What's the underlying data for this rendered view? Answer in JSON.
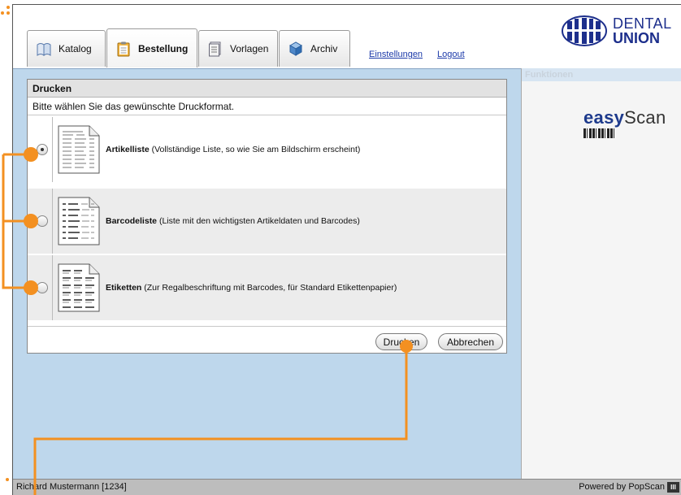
{
  "tabs": [
    {
      "label": "Katalog",
      "icon": "book-icon"
    },
    {
      "label": "Bestellung",
      "icon": "clipboard-icon",
      "active": true
    },
    {
      "label": "Vorlagen",
      "icon": "template-icon"
    },
    {
      "label": "Archiv",
      "icon": "archive-box-icon"
    }
  ],
  "header_links": {
    "settings": "Einstellungen",
    "logout": "Logout"
  },
  "logo": {
    "line1": "DENTAL",
    "line2": "UNION"
  },
  "functions": {
    "title": "Funktionen",
    "easy": "easy",
    "scan": "Scan"
  },
  "dialog": {
    "title": "Drucken",
    "intro": "Bitte wählen Sie das gewünschte Druckformat.",
    "options": [
      {
        "name": "Artikelliste",
        "desc": " (Vollständige Liste, so wie Sie am Bildschirm erscheint)",
        "checked": true
      },
      {
        "name": "Barcodeliste",
        "desc": " (Liste mit den wichtigsten Artikeldaten und Barcodes)",
        "checked": false
      },
      {
        "name": "Etiketten",
        "desc": " (Zur Regalbeschriftung mit Barcodes, für Standard Etikettenpapier)",
        "checked": false
      }
    ],
    "buttons": {
      "print": "Drucken",
      "cancel": "Abbrechen"
    }
  },
  "status": {
    "user": "Richard Mustermann [1234]",
    "powered": "Powered by PopScan",
    "logo_text": "III"
  },
  "colors": {
    "accent": "#f39021",
    "brand": "#1d2f8c",
    "panel": "#bed7ec"
  }
}
